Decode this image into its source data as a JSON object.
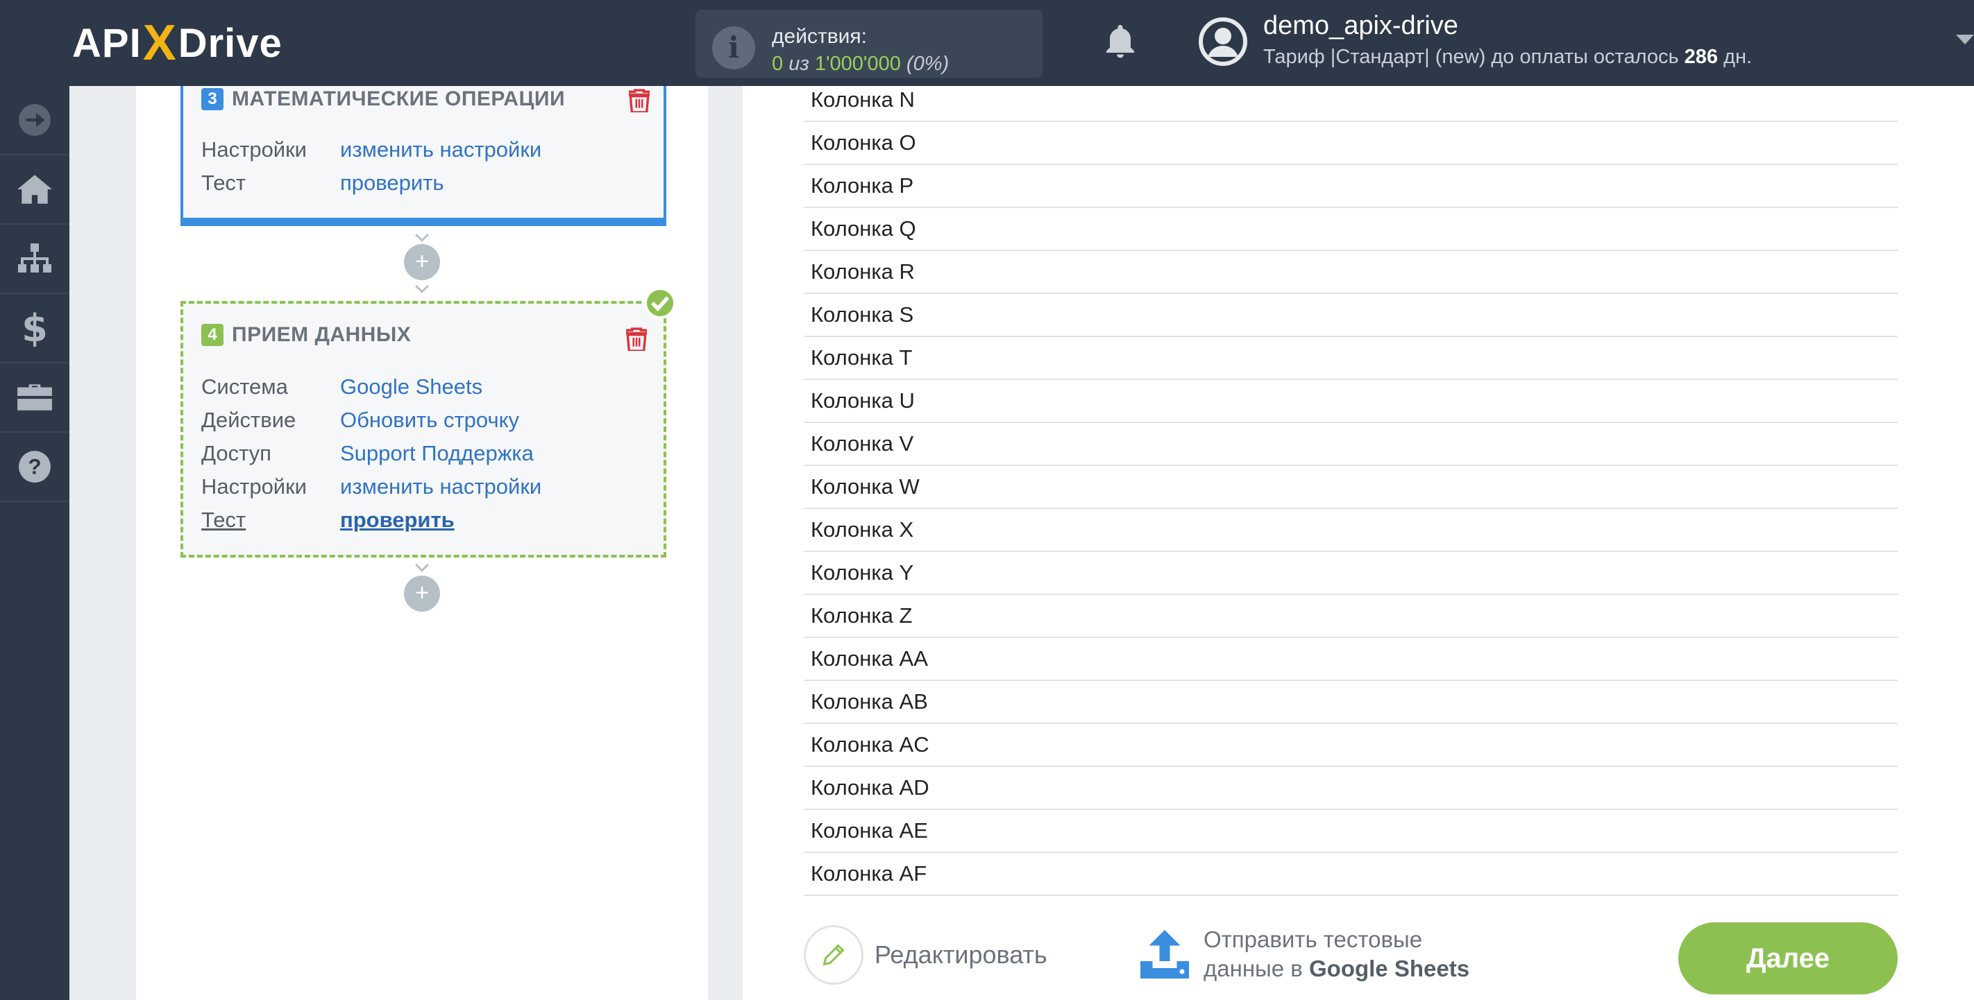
{
  "header": {
    "logo": {
      "left": "API",
      "x": "X",
      "right": "Drive"
    },
    "actions": {
      "title": "действия:",
      "used": "0",
      "of": "из",
      "limit": "1'000'000",
      "percent": "(0%)"
    },
    "user": {
      "name": "demo_apix-drive",
      "plan_prefix": "Тариф |Стандарт| (new) до оплаты осталось",
      "days": "286",
      "days_suffix": "дн."
    }
  },
  "sidebar": {
    "items": [
      "arrow-right-icon",
      "home-icon",
      "sitemap-icon",
      "dollar-icon",
      "briefcase-icon",
      "help-icon"
    ]
  },
  "flow": {
    "step3": {
      "number": "3",
      "title": "МАТЕМАТИЧЕСКИЕ ОПЕРАЦИИ",
      "rows": [
        {
          "key": "Настройки",
          "value": "изменить настройки"
        },
        {
          "key": "Тест",
          "value": "проверить"
        }
      ]
    },
    "step4": {
      "number": "4",
      "title": "ПРИЕМ ДАННЫХ",
      "rows": [
        {
          "key": "Система",
          "value": "Google Sheets"
        },
        {
          "key": "Действие",
          "value": "Обновить строчку"
        },
        {
          "key": "Доступ",
          "value": "Support Поддержка"
        },
        {
          "key": "Настройки",
          "value": "изменить настройки"
        },
        {
          "key": "Тест",
          "value": "проверить"
        }
      ]
    },
    "plus_label": "+"
  },
  "columns": [
    "Колонка N",
    "Колонка O",
    "Колонка P",
    "Колонка Q",
    "Колонка R",
    "Колонка S",
    "Колонка T",
    "Колонка U",
    "Колонка V",
    "Колонка W",
    "Колонка X",
    "Колонка Y",
    "Колонка Z",
    "Колонка AA",
    "Колонка AB",
    "Колонка AC",
    "Колонка AD",
    "Колонка AE",
    "Колонка AF"
  ],
  "footer": {
    "edit_label": "Редактировать",
    "send_line1": "Отправить тестовые",
    "send_line2_prefix": "данные в",
    "send_line2_bold": "Google Sheets",
    "next_label": "Далее"
  },
  "colors": {
    "header_bg": "#2d3848",
    "accent_green": "#8cc152",
    "accent_blue": "#3b8de0",
    "link": "#2f73c6",
    "logo_yellow": "#f2b413"
  }
}
